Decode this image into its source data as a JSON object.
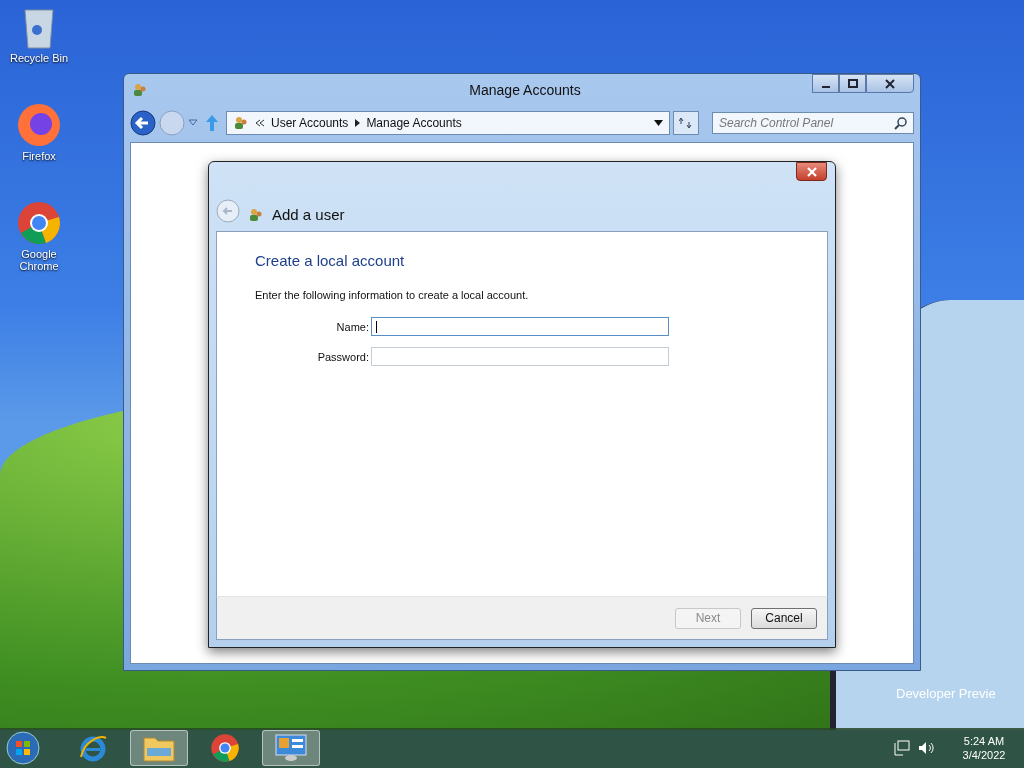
{
  "desktop_icons": [
    {
      "label": "Recycle Bin",
      "kind": "recycle"
    },
    {
      "label": "Firefox",
      "kind": "firefox"
    },
    {
      "label": "Google Chrome",
      "kind": "chrome"
    }
  ],
  "window": {
    "title": "Manage Accounts",
    "breadcrumb": [
      "User Accounts",
      "Manage Accounts"
    ],
    "search": {
      "placeholder": "Search Control Panel"
    }
  },
  "dialog": {
    "title": "Add a user",
    "heading": "Create a local account",
    "instruction": "Enter the following information to create a local account.",
    "fields": [
      {
        "label": "Name:",
        "focused": true
      },
      {
        "label": "Password:",
        "focused": false
      }
    ],
    "buttons": [
      {
        "label": "Next",
        "disabled": true
      },
      {
        "label": "Cancel",
        "disabled": false
      }
    ]
  },
  "desktop_watermark": "Developer Previe",
  "taskbar": {
    "apps": [
      {
        "kind": "ie",
        "active": false
      },
      {
        "kind": "explorer",
        "active": true
      },
      {
        "kind": "chrome",
        "active": false
      },
      {
        "kind": "control-panel",
        "active": true
      }
    ],
    "clock": {
      "time": "5:24 AM",
      "date": "3/4/2022"
    }
  }
}
